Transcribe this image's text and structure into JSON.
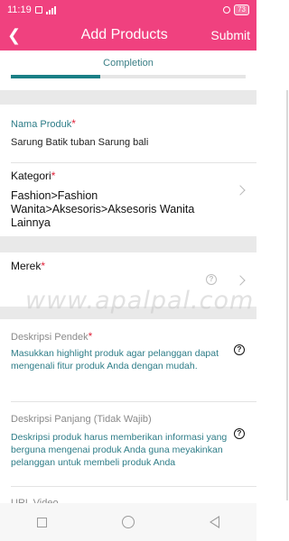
{
  "status": {
    "time": "11:19",
    "battery": "73"
  },
  "header": {
    "back_icon": "back-chevron-icon",
    "title": "Add Products",
    "submit": "Submit"
  },
  "progress": {
    "label": "Completion",
    "fraction": 0.38
  },
  "fields": {
    "nama_produk": {
      "label": "Nama Produk",
      "required": "*",
      "value": "Sarung Batik tuban Sarung bali"
    },
    "kategori": {
      "label": "Kategori",
      "required": "*",
      "value": "Fashion>Fashion Wanita>Aksesoris>Aksesoris Wanita Lainnya"
    },
    "merek": {
      "label": "Merek",
      "required": "*",
      "value": ""
    },
    "deskripsi_pendek": {
      "label": "Deskripsi Pendek",
      "required": "*",
      "placeholder": "Masukkan highlight produk agar pelanggan dapat mengenali fitur produk Anda dengan mudah."
    },
    "deskripsi_panjang": {
      "label": "Deskripsi Panjang (Tidak Wajib)",
      "placeholder": "Deskripsi produk harus memberikan informasi yang berguna mengenai produk Anda guna meyakinkan pelanggan untuk membeli produk Anda"
    },
    "url_video": {
      "label": "URL Video"
    }
  },
  "watermark": "www.apalpal.com",
  "colors": {
    "primary": "#f0417f",
    "accent": "#1a7f86",
    "required": "#e0243b"
  }
}
